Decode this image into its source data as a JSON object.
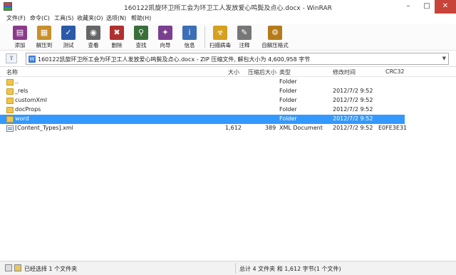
{
  "window": {
    "title": "160122凯旋环卫所工会为环卫工人发放爱心鸣鬓及点心.docx - WinRAR",
    "min_icon": "minimize-icon",
    "max_icon": "maximize-icon",
    "close_icon": "close-icon"
  },
  "menu": [
    "文件(F)",
    "命令(C)",
    "工具(S)",
    "收藏夹(O)",
    "选项(N)",
    "帮助(H)"
  ],
  "toolbar": [
    {
      "label": "添加",
      "icon": "add-archive-icon",
      "color": "#8b3a8b"
    },
    {
      "label": "解压到",
      "icon": "extract-to-icon",
      "color": "#c8902a"
    },
    {
      "label": "测试",
      "icon": "test-icon",
      "color": "#2a5aa8"
    },
    {
      "label": "查看",
      "icon": "view-icon",
      "color": "#666666"
    },
    {
      "label": "删除",
      "icon": "delete-icon",
      "color": "#b03030"
    },
    {
      "label": "查找",
      "icon": "find-icon",
      "color": "#3a6f3a"
    },
    {
      "label": "向导",
      "icon": "wizard-icon",
      "color": "#7a3f8f"
    },
    {
      "label": "信息",
      "icon": "info-icon",
      "color": "#3b6fb6"
    },
    {
      "label": "扫描病毒",
      "icon": "virus-scan-icon",
      "color": "#d4a020"
    },
    {
      "label": "注释",
      "icon": "comment-icon",
      "color": "#777777"
    },
    {
      "label": "自解压格式",
      "icon": "sfx-icon",
      "color": "#b57b1a"
    }
  ],
  "address": {
    "up_icon": "up-folder-icon",
    "text": "160122凯旋环卫所工会为环卫工人发放爱心鸣鬓及点心.docx - ZIP 压缩文件, 解包大小为 4,600,958 字节"
  },
  "columns": {
    "name": "名称",
    "size": "大小",
    "packed": "压缩后大小",
    "type": "类型",
    "modified": "修改时间",
    "crc": "CRC32"
  },
  "files": [
    {
      "name": "..",
      "size": "",
      "packed": "",
      "type": "Folder",
      "modified": "",
      "crc": "",
      "icon": "parent-folder-icon"
    },
    {
      "name": "_rels",
      "size": "",
      "packed": "",
      "type": "Folder",
      "modified": "2012/7/2 9:52",
      "crc": "",
      "icon": "folder-icon"
    },
    {
      "name": "customXml",
      "size": "",
      "packed": "",
      "type": "Folder",
      "modified": "2012/7/2 9:52",
      "crc": "",
      "icon": "folder-icon"
    },
    {
      "name": "docProps",
      "size": "",
      "packed": "",
      "type": "Folder",
      "modified": "2012/7/2 9:52",
      "crc": "",
      "icon": "folder-icon"
    },
    {
      "name": "word",
      "size": "",
      "packed": "",
      "type": "Folder",
      "modified": "2012/7/2 9:52",
      "crc": "",
      "icon": "folder-icon",
      "selected": true
    },
    {
      "name": "[Content_Types].xml",
      "size": "1,612",
      "packed": "389",
      "type": "XML Document",
      "modified": "2012/7/2 9:52",
      "crc": "E0FE3E31",
      "icon": "xml-file-icon"
    }
  ],
  "status": {
    "left": "已经选择 1 个文件夹",
    "right": "总计 4 文件夹 和 1,612 字节(1 个文件)"
  }
}
